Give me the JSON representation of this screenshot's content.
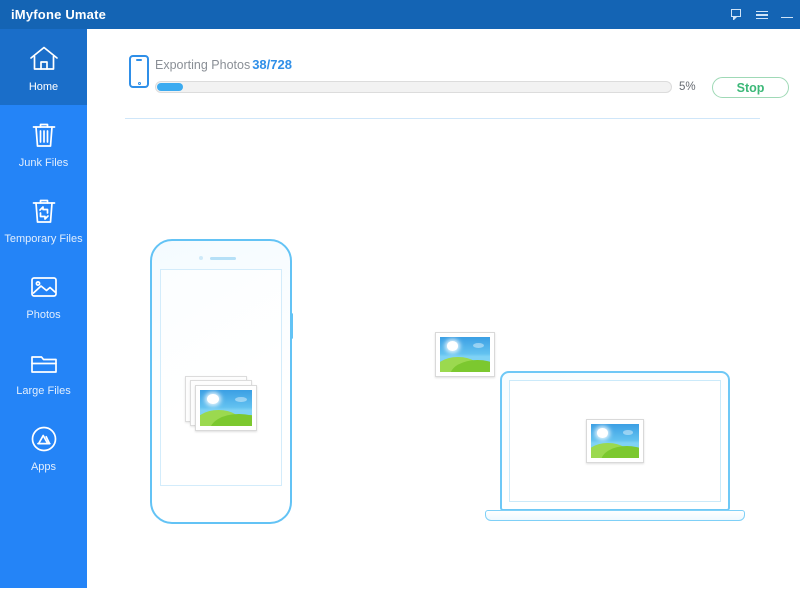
{
  "window": {
    "title": "iMyfone Umate",
    "controls": [
      {
        "name": "feedback-icon",
        "label": "Feedback"
      },
      {
        "name": "menu-icon",
        "label": "Menu"
      },
      {
        "name": "minimize-icon",
        "label": "Minimize"
      }
    ]
  },
  "sidebar": {
    "items": [
      {
        "label": "Home",
        "icon": "home-icon",
        "active": true
      },
      {
        "label": "Junk Files",
        "icon": "trash-icon",
        "active": false
      },
      {
        "label": "Temporary Files",
        "icon": "recycle-trash-icon",
        "active": false
      },
      {
        "label": "Photos",
        "icon": "photo-icon",
        "active": false
      },
      {
        "label": "Large Files",
        "icon": "folder-icon",
        "active": false
      },
      {
        "label": "Apps",
        "icon": "app-store-icon",
        "active": false
      }
    ]
  },
  "progress": {
    "status_text": "Exporting Photos",
    "counter": "38/728",
    "percent_label": "5%",
    "percent_value": 5,
    "stop_label": "Stop",
    "device_icon": "phone-icon"
  },
  "illustration": {
    "phone": {
      "name": "iphone-illustration",
      "content_icon": "photo-stack-icon"
    },
    "transfer": {
      "name": "transferring-photo-icon"
    },
    "laptop": {
      "name": "laptop-illustration",
      "content_icon": "photo-icon"
    }
  },
  "colors": {
    "titlebar": "#1464b4",
    "sidebar": "#2484f7",
    "sidebar_active": "#1a6ec9",
    "accent_blue": "#2f8fe8",
    "progress_fill": "#3cabf0",
    "stop_green": "#3cb878",
    "stop_border": "#9fd9b6",
    "outline_blue": "#63c3f5"
  }
}
